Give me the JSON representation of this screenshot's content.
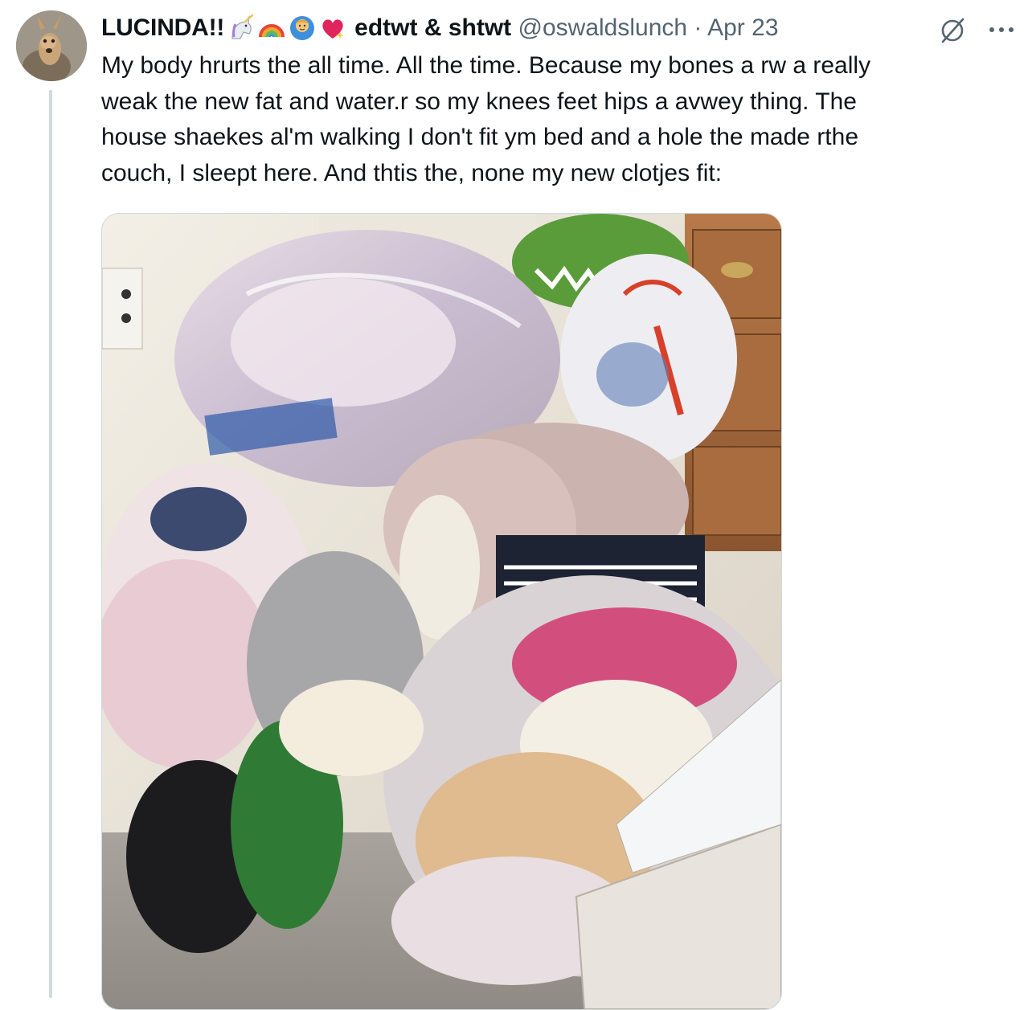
{
  "tweet": {
    "author": {
      "display_name": "LUCINDA!!",
      "name_emojis": [
        "unicorn-icon",
        "rainbow-icon",
        "person-icon",
        "sparkling-heart-icon"
      ],
      "bio_tag": "edtwt & shtwt",
      "handle": "@oswaldslunch",
      "separator": "·",
      "date": "Apr 23"
    },
    "text_lines": [
      "My body hrurts the all time. All the time. Because my bones a rw a really",
      "weak the new fat and water.r so my knees feet hips a avwey thing. The",
      "house shaekes al'm walking I don't fit ym bed and a hole the made rthe",
      "couch, I sleept here. And thtis the, none my new clotjes fit:"
    ],
    "actions": {
      "grok_icon": "grok-icon",
      "more_icon": "more-icon"
    },
    "media": {
      "type": "photo",
      "subject": "pile of clothes in plastic bags in a room corner"
    }
  },
  "colors": {
    "text": "#0f1419",
    "secondary_text": "#536471",
    "thread_line": "#cfd9de",
    "background": "#ffffff"
  }
}
